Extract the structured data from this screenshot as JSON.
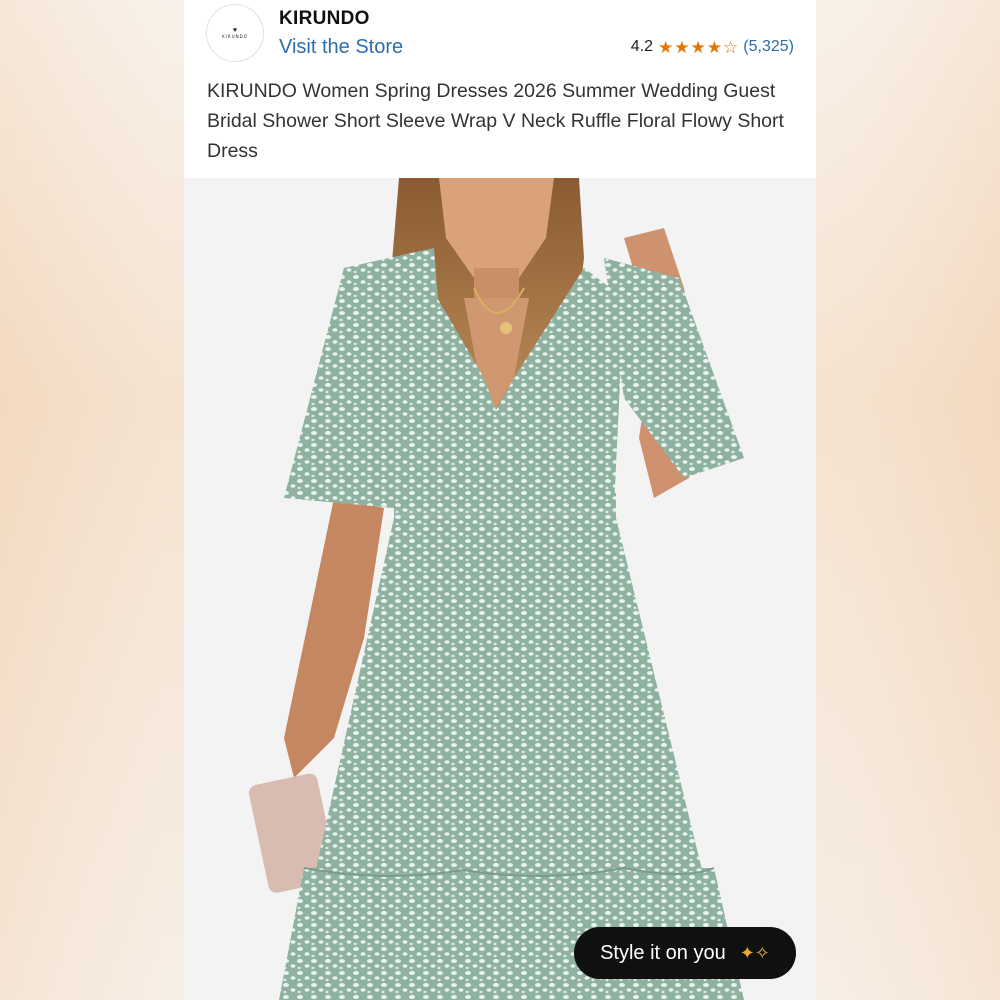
{
  "store": {
    "logo_text": "KIRUNDO",
    "name": "KIRUNDO",
    "visit_label": "Visit the Store"
  },
  "rating": {
    "value": "4.2",
    "stars": 4.2,
    "review_count": "(5,325)",
    "star_color": "#e77600"
  },
  "product": {
    "title": "KIRUNDO Women Spring Dresses 2026 Summer Wedding Guest Bridal Shower Short Sleeve Wrap V Neck Ruffle Floral Flowy Short Dress",
    "image_icon": "product-photo-dress"
  },
  "actions": {
    "style_button_label": "Style it on you",
    "style_button_icon": "sparkle-icon"
  },
  "colors": {
    "link": "#2a6ead",
    "dress": "#9fbfae",
    "button_bg": "#0f1111"
  }
}
